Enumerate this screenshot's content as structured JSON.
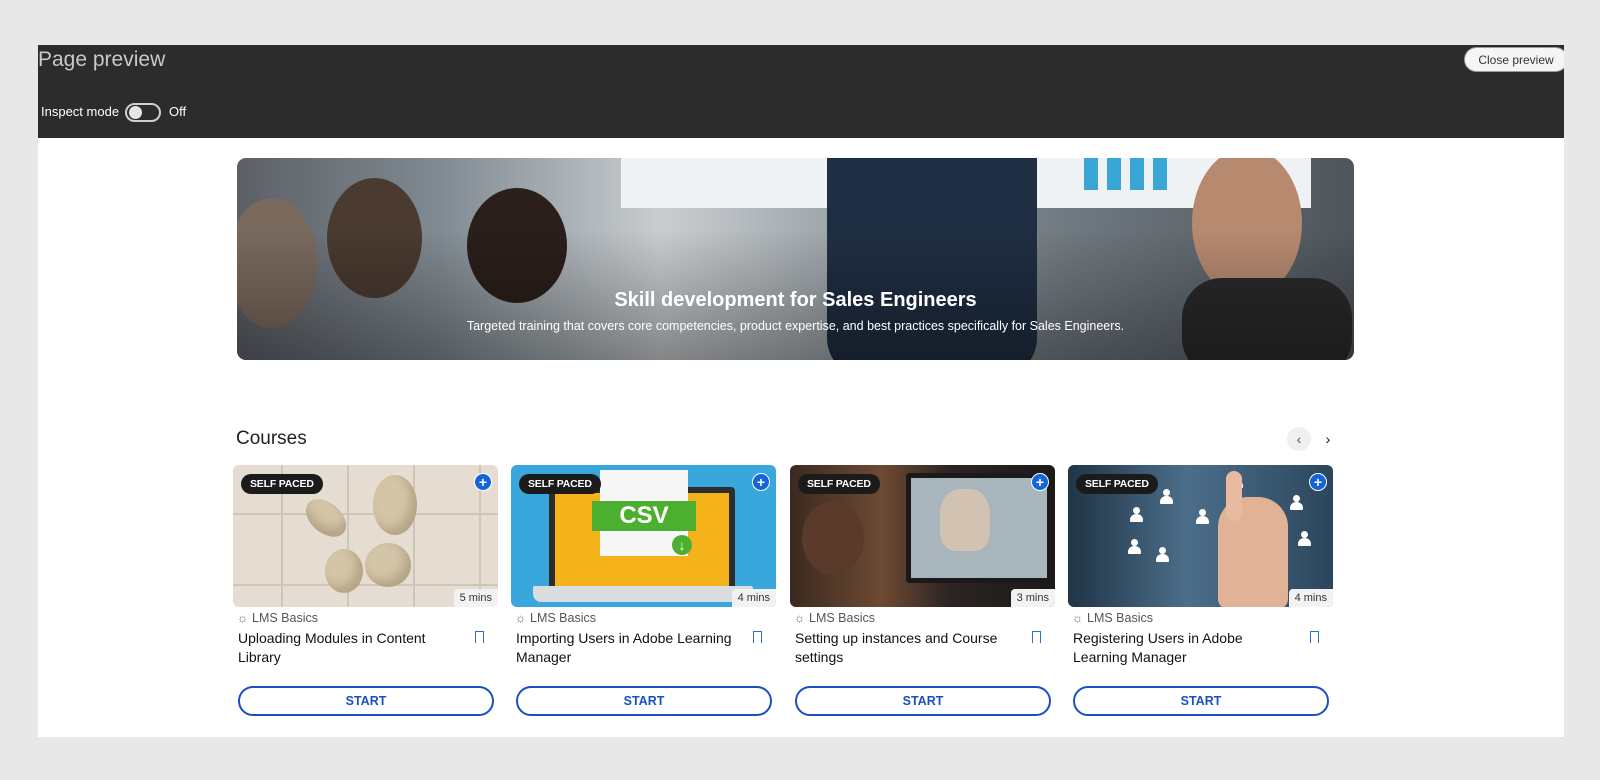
{
  "preview_bar": {
    "title": "Page preview",
    "close_label": "Close preview",
    "inspect_label": "Inspect mode",
    "inspect_state": "Off"
  },
  "hero": {
    "title": "Skill development for Sales Engineers",
    "subtitle": "Targeted training that covers core competencies, product expertise, and best practices specifically for Sales Engineers."
  },
  "courses": {
    "heading": "Courses",
    "prev_icon": "chevron-left-icon",
    "next_icon": "chevron-right-icon",
    "items": [
      {
        "badge": "SELF PACED",
        "duration": "5 mins",
        "category": "LMS Basics",
        "title": "Uploading Modules in Content Library",
        "cta": "START"
      },
      {
        "badge": "SELF PACED",
        "duration": "4 mins",
        "category": "LMS Basics",
        "title": "Importing Users in Adobe Learning Manager",
        "cta": "START",
        "thumb_text": "CSV"
      },
      {
        "badge": "SELF PACED",
        "duration": "3 mins",
        "category": "LMS Basics",
        "title": "Setting up instances and Course settings",
        "cta": "START"
      },
      {
        "badge": "SELF PACED",
        "duration": "4 mins",
        "category": "LMS Basics",
        "title": "Registering Users in Adobe Learning Manager",
        "cta": "START"
      }
    ]
  },
  "colors": {
    "accent": "#1a4fc4",
    "add_button": "#1565d8",
    "topbar": "#2c2c2c"
  }
}
